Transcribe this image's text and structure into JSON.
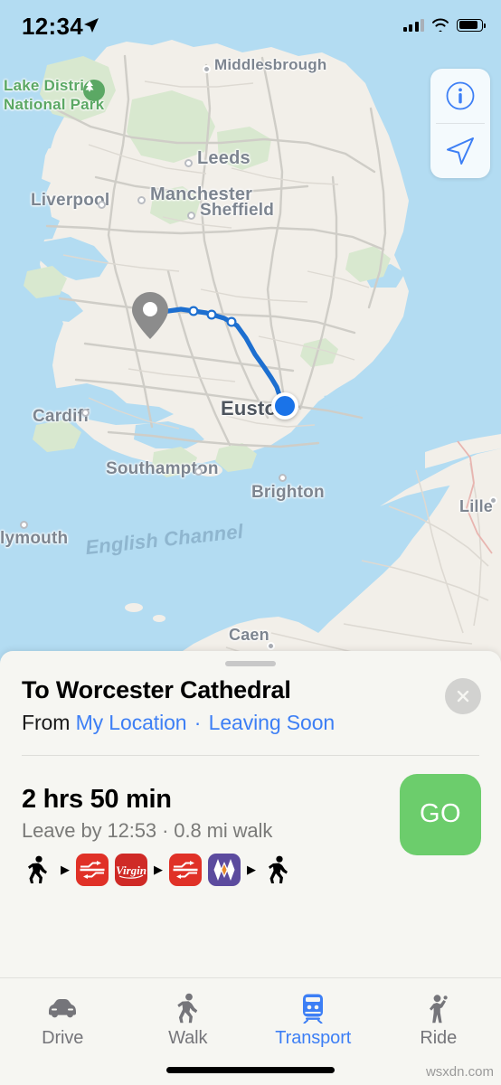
{
  "status_bar": {
    "time": "12:34",
    "location_arrow_icon": "location-arrow-icon",
    "cellular_icon": "cellular-signal-icon",
    "wifi_icon": "wifi-icon",
    "battery_icon": "battery-icon"
  },
  "map": {
    "info_icon": "info-circle-icon",
    "locate_icon": "navigation-arrow-icon",
    "destination_pin_icon": "map-pin-icon",
    "current_location_icon": "blue-location-dot",
    "labels": [
      {
        "text": "Lake District National Park",
        "type": "park"
      },
      {
        "text": "Middlesbrough",
        "type": "city"
      },
      {
        "text": "Leeds",
        "type": "city"
      },
      {
        "text": "Liverpool",
        "type": "city"
      },
      {
        "text": "Manchester",
        "type": "city"
      },
      {
        "text": "Sheffield",
        "type": "city"
      },
      {
        "text": "Cardiff",
        "type": "city"
      },
      {
        "text": "Southampton",
        "type": "city"
      },
      {
        "text": "Brighton",
        "type": "city"
      },
      {
        "text": "Plymouth",
        "type": "city"
      },
      {
        "text": "Euston",
        "type": "station"
      },
      {
        "text": "Caen",
        "type": "city"
      },
      {
        "text": "Lille",
        "type": "city"
      },
      {
        "text": "English Channel",
        "type": "sea"
      }
    ],
    "label_lake_district_line1": "Lake District",
    "label_lake_district_line2": "National Park",
    "label_middlesbrough": "Middlesbrough",
    "label_leeds": "Leeds",
    "label_liverpool": "Liverpool",
    "label_manchester": "Manchester",
    "label_sheffield": "Sheffield",
    "label_cardiff": "Cardiff",
    "label_southampton": "Southampton",
    "label_brighton": "Brighton",
    "label_plymouth": "lymouth",
    "label_euston": "Euston",
    "label_caen": "Caen",
    "label_lille": "Lille",
    "label_english_channel": "English Channel",
    "colors": {
      "sea": "#b3dcf2",
      "land": "#f2efe9",
      "park": "#d8e8cf",
      "route": "#1d6fd0",
      "pin": "#8c8c8c"
    }
  },
  "sheet": {
    "destination": "To Worcester Cathedral",
    "from_prefix": "From",
    "from_location": "My Location",
    "separator": "·",
    "departure": "Leaving Soon",
    "close_icon": "close-x-icon",
    "grabber": "sheet-grabber"
  },
  "route": {
    "duration": "2 hrs 50 min",
    "details": "Leave by 12:53 · 0.8 mi walk",
    "go_label": "GO",
    "go_color": "#6ccd6c",
    "legs": [
      {
        "type": "walk",
        "icon": "walking-person-icon",
        "label": "Walk"
      },
      {
        "type": "arrow",
        "icon": "triangle-right-icon",
        "label": ""
      },
      {
        "type": "operator",
        "icon": "national-rail-icon",
        "label": "National Rail",
        "color": "#e03127"
      },
      {
        "type": "operator",
        "icon": "virgin-trains-icon",
        "label": "Virgin",
        "color": "#cf2a26"
      },
      {
        "type": "arrow",
        "icon": "triangle-right-icon",
        "label": ""
      },
      {
        "type": "operator",
        "icon": "national-rail-icon",
        "label": "National Rail",
        "color": "#e03127"
      },
      {
        "type": "operator",
        "icon": "west-midlands-trains-icon",
        "label": "West Midlands",
        "color": "#5c4b9e"
      },
      {
        "type": "arrow",
        "icon": "triangle-right-icon",
        "label": ""
      },
      {
        "type": "walk",
        "icon": "walking-person-icon",
        "label": "Walk"
      }
    ]
  },
  "tabbar": {
    "accent": "#3d7ff5",
    "tabs": [
      {
        "label": "Drive",
        "icon": "car-icon",
        "active": false
      },
      {
        "label": "Walk",
        "icon": "walking-person-icon",
        "active": false
      },
      {
        "label": "Transport",
        "icon": "train-icon",
        "active": true
      },
      {
        "label": "Ride",
        "icon": "hailing-person-icon",
        "active": false
      }
    ]
  },
  "watermark": "wsxdn.com"
}
